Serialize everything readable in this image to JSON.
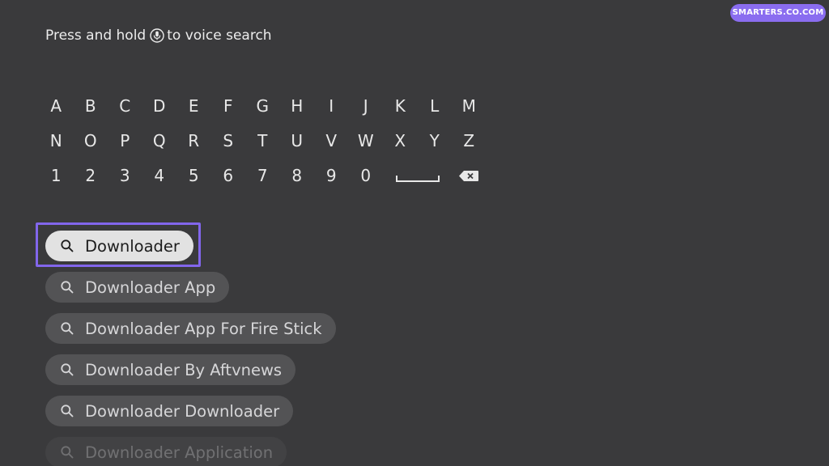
{
  "voice_hint": {
    "before": "Press and hold",
    "after": "to voice search",
    "icon": "microphone-icon"
  },
  "watermark": "SMARTERS.CO.COM",
  "keyboard": {
    "row1": [
      "A",
      "B",
      "C",
      "D",
      "E",
      "F",
      "G",
      "H",
      "I",
      "J",
      "K",
      "L",
      "M"
    ],
    "row2": [
      "N",
      "O",
      "P",
      "Q",
      "R",
      "S",
      "T",
      "U",
      "V",
      "W",
      "X",
      "Y",
      "Z"
    ],
    "row3": [
      "1",
      "2",
      "3",
      "4",
      "5",
      "6",
      "7",
      "8",
      "9",
      "0"
    ],
    "space_icon": "space-bar-icon",
    "backspace_icon": "backspace-icon"
  },
  "suggestions": [
    {
      "label": "Downloader",
      "selected": true
    },
    {
      "label": "Downloader App",
      "selected": false
    },
    {
      "label": "Downloader App For Fire Stick",
      "selected": false
    },
    {
      "label": "Downloader By Aftvnews",
      "selected": false
    },
    {
      "label": "Downloader Downloader",
      "selected": false
    },
    {
      "label": "Downloader Application",
      "selected": false
    }
  ],
  "colors": {
    "background": "#3a3a3c",
    "focus_ring": "#8266ec",
    "watermark_bg": "#8a6df0",
    "selected_chip": "#e2e2e2",
    "chip": "#535355"
  }
}
